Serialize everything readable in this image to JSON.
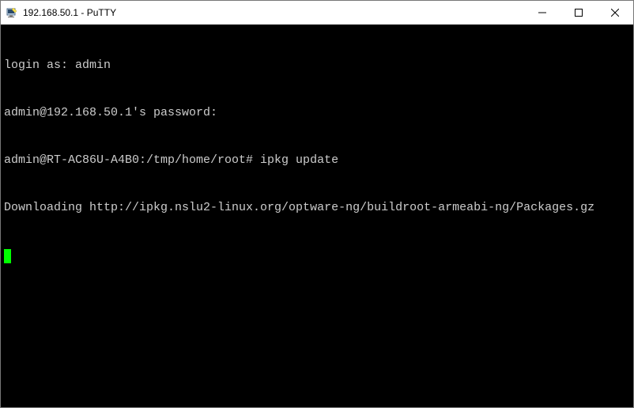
{
  "window": {
    "title": "192.168.50.1 - PuTTY"
  },
  "terminal": {
    "lines": [
      "login as: admin",
      "admin@192.168.50.1's password:",
      "admin@RT-AC86U-A4B0:/tmp/home/root# ipkg update",
      "Downloading http://ipkg.nslu2-linux.org/optware-ng/buildroot-armeabi-ng/Packages.gz"
    ]
  }
}
